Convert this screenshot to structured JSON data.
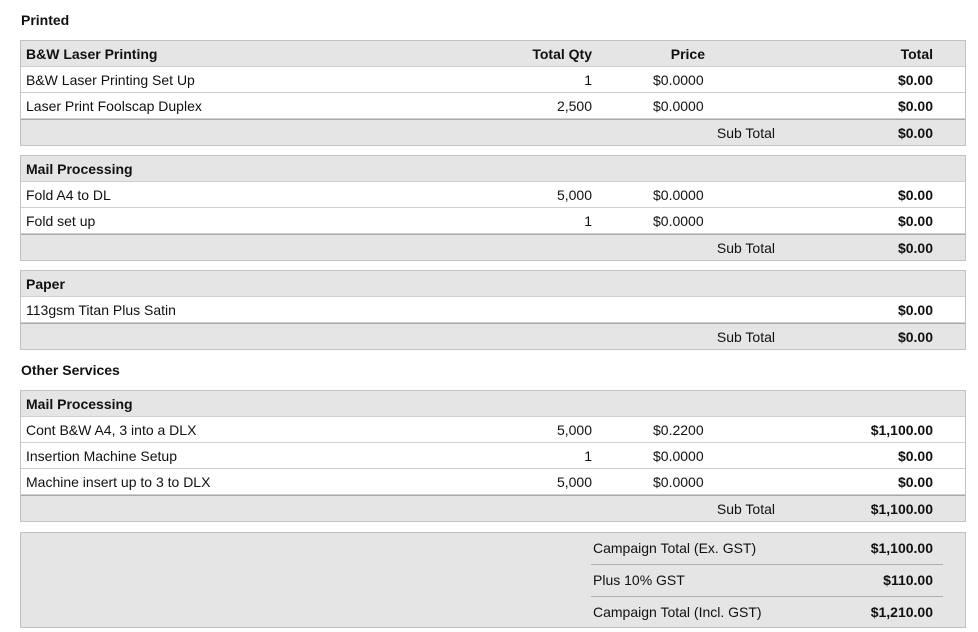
{
  "section_printed": "Printed",
  "section_other": "Other Services",
  "columns": {
    "qty": "Total Qty",
    "price": "Price",
    "total": "Total"
  },
  "groups": [
    {
      "title": "B&W Laser Printing",
      "items": [
        {
          "desc": "B&W Laser Printing Set Up",
          "qty": "1",
          "price": "$0.0000",
          "total": "$0.00"
        },
        {
          "desc": "Laser Print Foolscap Duplex",
          "qty": "2,500",
          "price": "$0.0000",
          "total": "$0.00"
        }
      ],
      "subtotal_label": "Sub Total",
      "subtotal": "$0.00"
    },
    {
      "title": "Mail Processing",
      "items": [
        {
          "desc": "Fold A4 to DL",
          "qty": "5,000",
          "price": "$0.0000",
          "total": "$0.00"
        },
        {
          "desc": "Fold set up",
          "qty": "1",
          "price": "$0.0000",
          "total": "$0.00"
        }
      ],
      "subtotal_label": "Sub Total",
      "subtotal": "$0.00"
    },
    {
      "title": "Paper",
      "items": [
        {
          "desc": "113gsm Titan Plus Satin",
          "qty": "",
          "price": "",
          "total": "$0.00"
        }
      ],
      "subtotal_label": "Sub Total",
      "subtotal": "$0.00"
    },
    {
      "title": "Mail Processing",
      "items": [
        {
          "desc": "Cont B&W A4, 3 into a DLX",
          "qty": "5,000",
          "price": "$0.2200",
          "total": "$1,100.00"
        },
        {
          "desc": "Insertion Machine Setup",
          "qty": "1",
          "price": "$0.0000",
          "total": "$0.00"
        },
        {
          "desc": "Machine insert up to 3 to DLX",
          "qty": "5,000",
          "price": "$0.0000",
          "total": "$0.00"
        }
      ],
      "subtotal_label": "Sub Total",
      "subtotal": "$1,100.00"
    }
  ],
  "totals": [
    {
      "label": "Campaign Total (Ex. GST)",
      "value": "$1,100.00"
    },
    {
      "label": "Plus 10% GST",
      "value": "$110.00"
    },
    {
      "label": "Campaign Total (Incl. GST)",
      "value": "$1,210.00"
    }
  ]
}
